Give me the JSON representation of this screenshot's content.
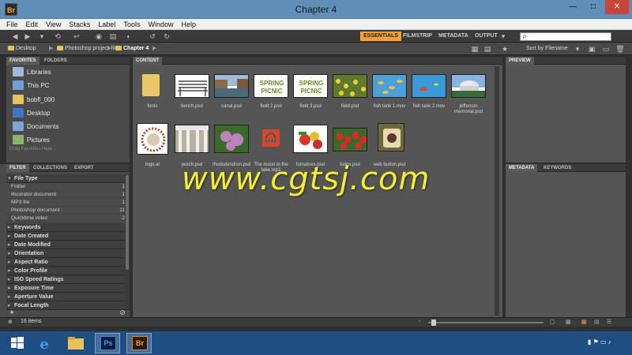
{
  "window": {
    "title": "Chapter 4",
    "app_icon": "Br"
  },
  "menu": [
    "File",
    "Edit",
    "View",
    "Stacks",
    "Label",
    "Tools",
    "Window",
    "Help"
  ],
  "workspaces": [
    {
      "label": "ESSENTIALS",
      "active": true
    },
    {
      "label": "FILMSTRIP",
      "active": false
    },
    {
      "label": "METADATA",
      "active": false
    },
    {
      "label": "OUTPUT",
      "active": false
    }
  ],
  "search": {
    "placeholder": "ρ·"
  },
  "sort": {
    "label": "Sort by Filename"
  },
  "path": [
    "Desktop",
    "Photoshop project files",
    "Chapter 4"
  ],
  "favorites_panel": {
    "tabs": [
      "FAVORITES",
      "FOLDERS"
    ],
    "items": [
      {
        "label": "Libraries",
        "icon": "libraries-icon"
      },
      {
        "label": "This PC",
        "icon": "computer-icon"
      },
      {
        "label": "bobfl_000",
        "icon": "user-folder-icon"
      },
      {
        "label": "Desktop",
        "icon": "desktop-icon"
      },
      {
        "label": "Documents",
        "icon": "documents-icon"
      },
      {
        "label": "Pictures",
        "icon": "pictures-icon"
      }
    ],
    "hint": "Drag Favorites Here..."
  },
  "filter_panel": {
    "tabs": [
      "FILTER",
      "COLLECTIONS",
      "EXPORT"
    ],
    "open_section": "File Type",
    "file_types": [
      {
        "label": "Folder",
        "count": "1"
      },
      {
        "label": "Illustrator document",
        "count": "1"
      },
      {
        "label": "MP3 file",
        "count": "1"
      },
      {
        "label": "Photoshop document",
        "count": "11"
      },
      {
        "label": "Quicktime video",
        "count": "2"
      }
    ],
    "sections": [
      "Keywords",
      "Date Created",
      "Date Modified",
      "Orientation",
      "Aspect Ratio",
      "Color Profile",
      "ISO Speed Ratings",
      "Exposure Time",
      "Aperture Value",
      "Focal Length"
    ]
  },
  "content_panel": {
    "tab": "CONTENT",
    "items": [
      {
        "label": "fonts",
        "kind": "folder"
      },
      {
        "label": "bench.psd",
        "kind": "bench"
      },
      {
        "label": "canal.psd",
        "kind": "canal"
      },
      {
        "label": "field 2.psd",
        "kind": "spring"
      },
      {
        "label": "field 3.psd",
        "kind": "spring"
      },
      {
        "label": "field.psd",
        "kind": "flowers-yellow"
      },
      {
        "label": "fish tank 1.mov",
        "kind": "fish"
      },
      {
        "label": "fish tank 2.mov",
        "kind": "fish2"
      },
      {
        "label": "jefferson memorial.psd",
        "kind": "memorial"
      },
      {
        "label": "logo.ai",
        "kind": "logo"
      },
      {
        "label": "porch.psd",
        "kind": "porch"
      },
      {
        "label": "rhododendron.psd",
        "kind": "rhodo"
      },
      {
        "label": "The moon in the lake.mp3",
        "kind": "music"
      },
      {
        "label": "tomatoes.psd",
        "kind": "tomatoes"
      },
      {
        "label": "tulips.psd",
        "kind": "tulips"
      },
      {
        "label": "web button.psd",
        "kind": "webbutton"
      }
    ]
  },
  "thumb_text": {
    "spring_line1": "SPRING",
    "spring_line2": "PICNIC"
  },
  "preview_panel": {
    "tab": "PREVIEW"
  },
  "metadata_panel": {
    "tabs": [
      "METADATA",
      "KEYWORDS"
    ]
  },
  "status": {
    "items_count": "16 items"
  },
  "watermark": "www.cgtsj.com",
  "taskbar": {
    "apps": [
      "start",
      "internet-explorer",
      "file-explorer",
      "photoshop",
      "bridge"
    ],
    "ps_label": "Ps",
    "br_label": "Br"
  },
  "colors": {
    "accent": "#f0a33a",
    "titlebar": "#5f8fb8",
    "taskbar": "#1f4f82",
    "watermark": "#f6ef2e"
  }
}
